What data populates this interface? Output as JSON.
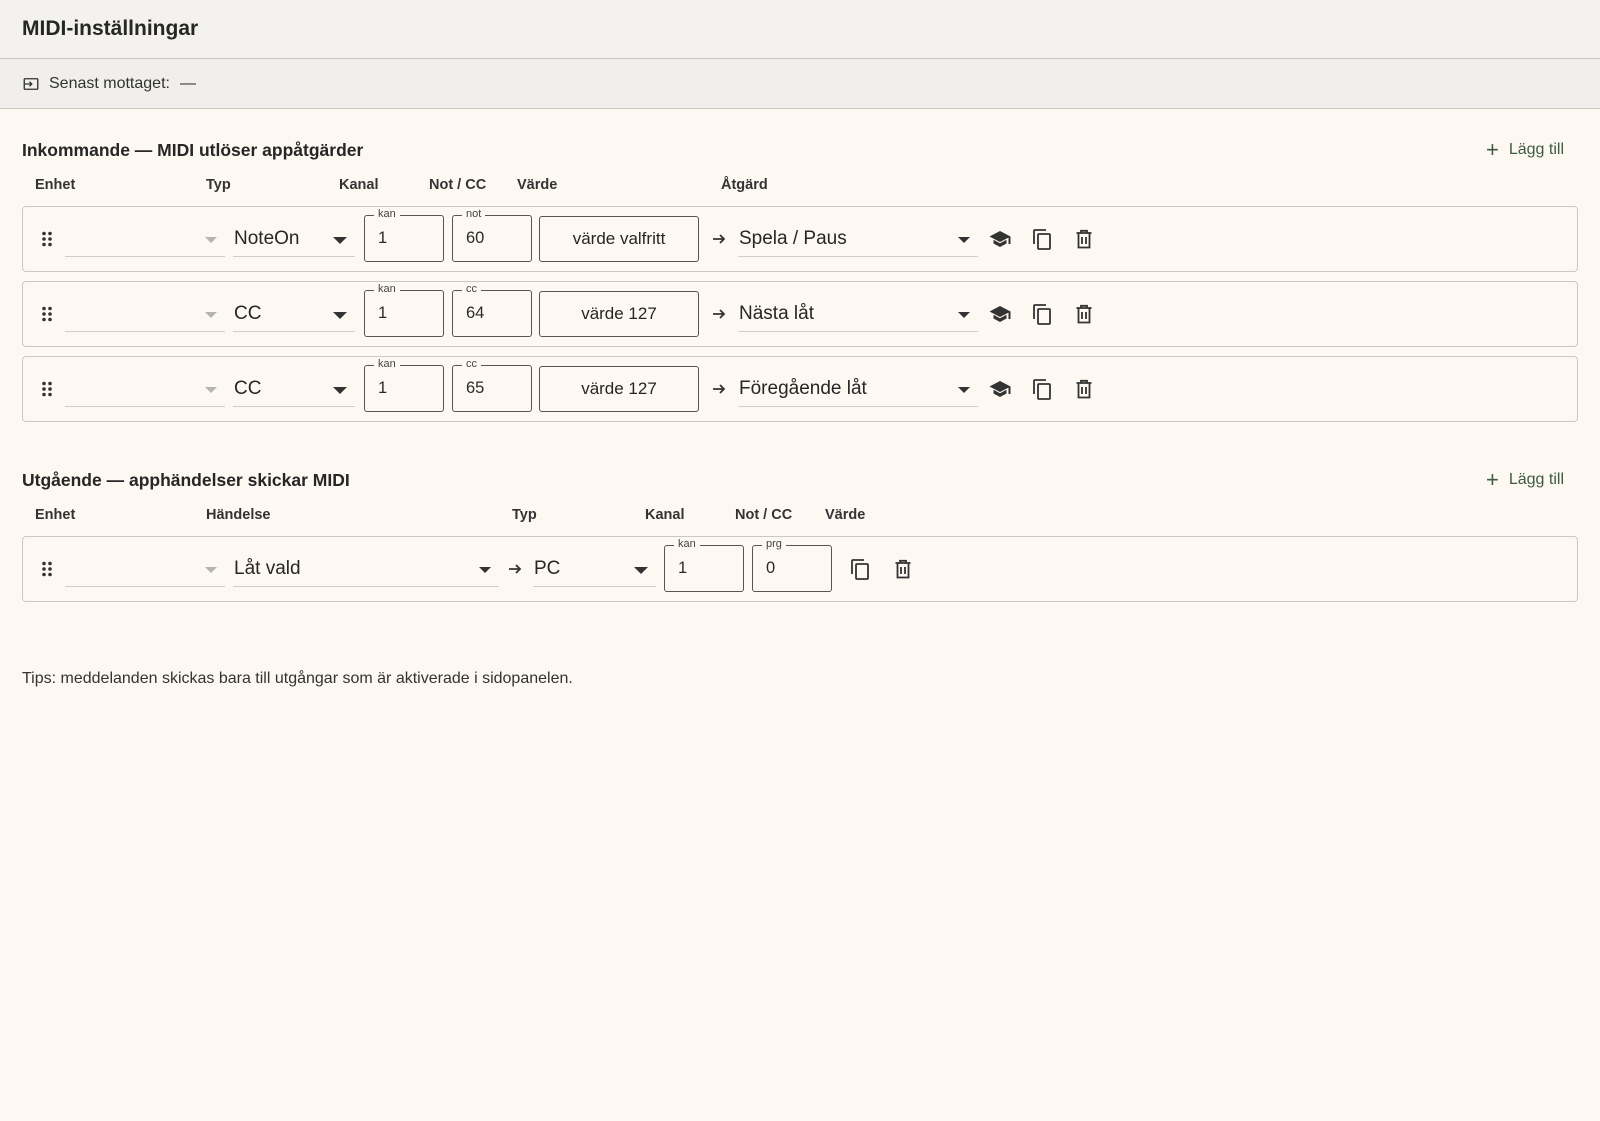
{
  "header": {
    "title": "MIDI-inställningar"
  },
  "status": {
    "label": "Senast mottaget:",
    "value": "—"
  },
  "incoming": {
    "title": "Inkommande — MIDI utlöser appåtgärder",
    "add_label": "Lägg till",
    "columns": [
      "Enhet",
      "Typ",
      "Kanal",
      "Not / CC",
      "Värde",
      "Åtgärd"
    ],
    "rows": [
      {
        "device": "",
        "type": "NoteOn",
        "channel_label": "kan",
        "channel": "1",
        "num_label": "not",
        "num": "60",
        "value": "värde valfritt",
        "action": "Spela / Paus"
      },
      {
        "device": "",
        "type": "CC",
        "channel_label": "kan",
        "channel": "1",
        "num_label": "cc",
        "num": "64",
        "value": "värde 127",
        "action": "Nästa låt"
      },
      {
        "device": "",
        "type": "CC",
        "channel_label": "kan",
        "channel": "1",
        "num_label": "cc",
        "num": "65",
        "value": "värde 127",
        "action": "Föregående låt"
      }
    ]
  },
  "outgoing": {
    "title": "Utgående — apphändelser skickar MIDI",
    "add_label": "Lägg till",
    "columns": [
      "Enhet",
      "Händelse",
      "Typ",
      "Kanal",
      "Not / CC",
      "Värde"
    ],
    "rows": [
      {
        "device": "",
        "event": "Låt vald",
        "type": "PC",
        "channel_label": "kan",
        "channel": "1",
        "num_label": "prg",
        "num": "0"
      }
    ]
  },
  "tip": "Tips: meddelanden skickas bara till utgångar som är aktiverade i sidopanelen.",
  "icons": {
    "status": "input-icon",
    "drag": "drag-handle-icon",
    "learn": "learn-cap-icon",
    "duplicate": "duplicate-icon",
    "delete": "trash-icon",
    "arrow": "arrow-right-icon",
    "add": "plus-icon"
  },
  "colors": {
    "background": "#fdf8f2",
    "accent": "#3d5a45",
    "border": "#c9c9c4"
  }
}
